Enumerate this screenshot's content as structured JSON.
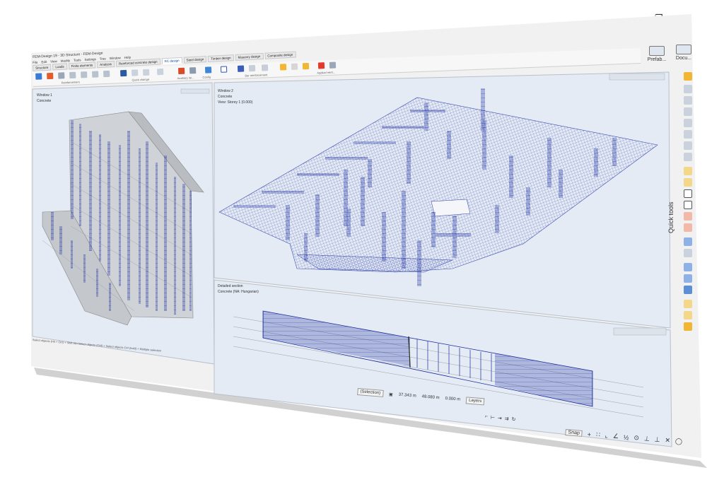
{
  "window": {
    "title": "FEM-Design 19 - 3D Structure - FEM-Design",
    "minimize": "‒",
    "restore": "❐",
    "close": "✕"
  },
  "menu": [
    "File",
    "Edit",
    "View",
    "Modify",
    "Tools",
    "Settings",
    "Tree",
    "Window",
    "Help"
  ],
  "tabs": [
    {
      "label": "Structure",
      "active": false
    },
    {
      "label": "Loads",
      "active": false
    },
    {
      "label": "Finite elements",
      "active": false
    },
    {
      "label": "Analysis",
      "active": false
    },
    {
      "label": "Reinforced concrete design",
      "active": false
    },
    {
      "label": "RC design",
      "active": true
    },
    {
      "label": "Steel design",
      "active": false
    },
    {
      "label": "Timber design",
      "active": false
    },
    {
      "label": "Masonry design",
      "active": false
    },
    {
      "label": "Composite design",
      "active": false
    }
  ],
  "ribbon_groups": [
    "Reinforcement",
    "Quick change",
    "Auxiliary rei...",
    "Config",
    "Bar reinforcement",
    "Applied reinf..."
  ],
  "side_panels": {
    "prefab": "Prefab...",
    "docu": "Docu..."
  },
  "quick_tools_label": "Quick tools",
  "viewports": {
    "left": {
      "title": "Window 1",
      "subtitle": "Concrete"
    },
    "center": {
      "title": "Window 2",
      "subtitle": "Concrete",
      "view": "View: Storey 1 (0.000)"
    },
    "bottom": {
      "title": "Detailed section",
      "subtitle": "Concrete (NA: Hungarian)"
    }
  },
  "status_text": "Select objects (Hit + Ctrl) + Shift Alt+Select objects (Ctrl) + Select objects Ctrl (hold) + Multiple selection",
  "bottom_bar": {
    "selection": "(Selection)",
    "x": "37.343 m",
    "y": "48.080 m",
    "z": "0.000 m",
    "layers": "Layers",
    "snap": "Snap"
  },
  "icons": {
    "accent": "#1a2a9e",
    "wire": "#2a3aa8",
    "bg_view": "#e8eef6"
  }
}
